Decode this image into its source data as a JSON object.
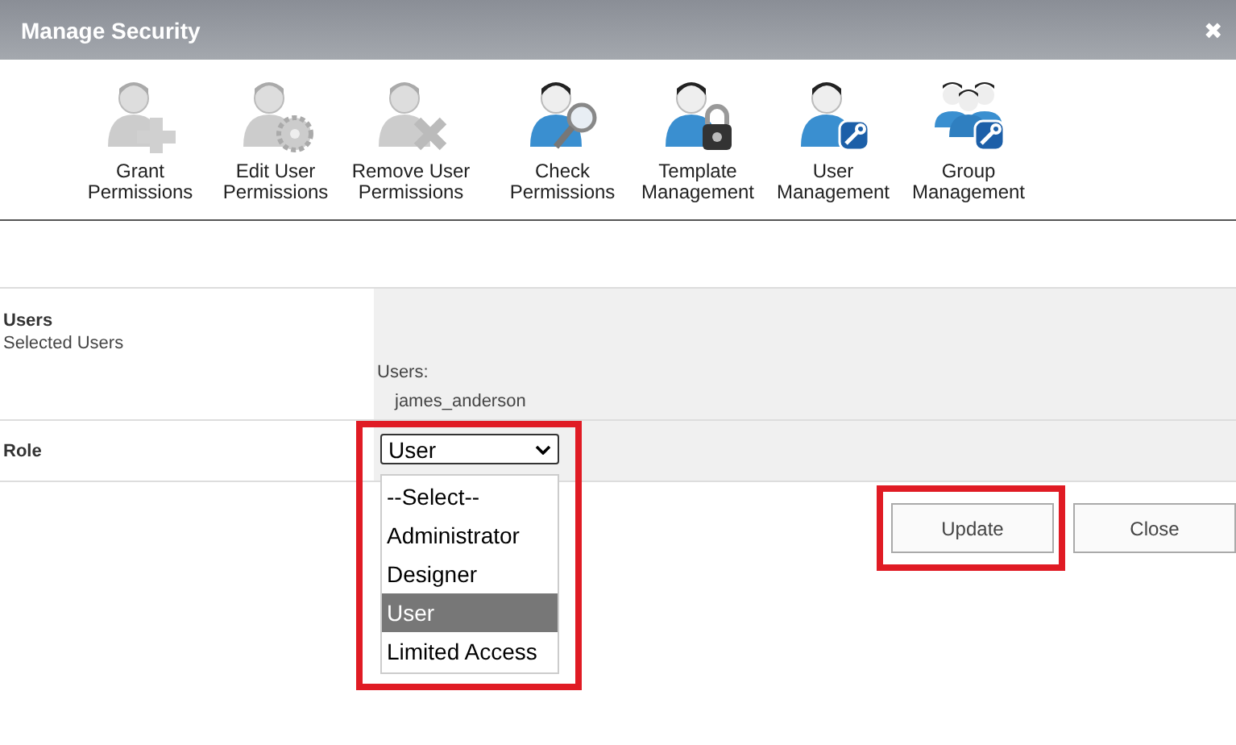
{
  "window": {
    "title": "Manage Security",
    "close": "✖"
  },
  "toolbar": [
    {
      "label": "Grant Permissions",
      "disabled": true
    },
    {
      "label": "Edit User Permissions",
      "disabled": true
    },
    {
      "label": "Remove User Permissions",
      "disabled": true
    },
    {
      "label": "Check Permissions",
      "disabled": false
    },
    {
      "label": "Template Management",
      "disabled": false
    },
    {
      "label": "User Management",
      "disabled": false
    },
    {
      "label": "Group Management",
      "disabled": false
    }
  ],
  "users": {
    "title": "Users",
    "subtitle": "Selected Users",
    "list_label": "Users:",
    "names": [
      "james_anderson"
    ]
  },
  "role": {
    "label": "Role",
    "value": "User",
    "expanded": true,
    "options": [
      {
        "label": "--Select--",
        "selected": false
      },
      {
        "label": "Administrator",
        "selected": false
      },
      {
        "label": "Designer",
        "selected": false
      },
      {
        "label": "User",
        "selected": true
      },
      {
        "label": "Limited Access",
        "selected": false
      }
    ]
  },
  "buttons": [
    "Update",
    "Close"
  ]
}
